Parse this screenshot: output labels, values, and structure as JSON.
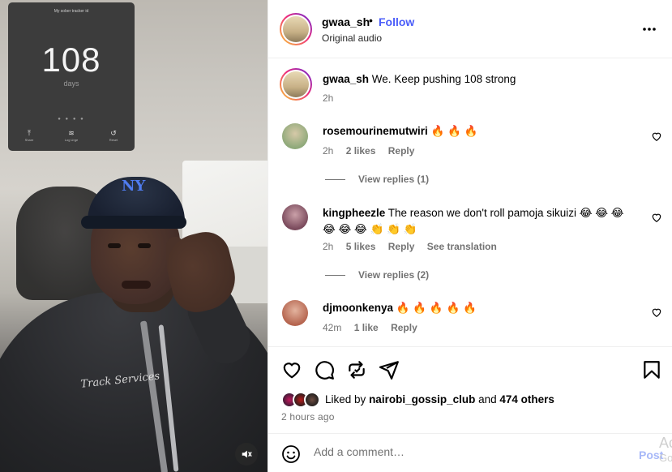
{
  "post": {
    "username": "gwaa_sh",
    "separator": "•",
    "follow_label": "Follow",
    "audio": "Original audio",
    "more_icon": "more-horizontal-icon"
  },
  "media": {
    "phone_goal_text": "My sober tracker id",
    "counter_value": "108",
    "counter_unit": "days",
    "controls": [
      {
        "glyph": "⤒",
        "label": "Share"
      },
      {
        "glyph": "≋",
        "label": "Log Urge"
      },
      {
        "glyph": "↺",
        "label": "Reset"
      }
    ],
    "mute_icon": "speaker-muted-icon",
    "cap_logo": "NY"
  },
  "caption": {
    "username": "gwaa_sh",
    "text": "We. Keep pushing 108 strong",
    "time": "2h"
  },
  "comments": [
    {
      "username": "rosemourinemutwiri",
      "text": "🔥 🔥 🔥",
      "time": "2h",
      "likes": "2 likes",
      "reply": "Reply",
      "view_replies": "View replies (1)",
      "avatar_color": "#8fa97a"
    },
    {
      "username": "kingpheezle",
      "text": "The reason we don't roll pamoja sikuizi 😂 😂 😂 😂 😂 😂 👏 👏 👏",
      "time": "2h",
      "likes": "5 likes",
      "reply": "Reply",
      "translation": "See translation",
      "view_replies": "View replies (2)",
      "avatar_color": "#7a4a5c"
    },
    {
      "username": "djmoonkenya",
      "text": "🔥 🔥 🔥 🔥 🔥",
      "time": "42m",
      "likes": "1 like",
      "reply": "Reply",
      "avatar_color": "#b5654f"
    }
  ],
  "actions": {
    "icons": [
      "heart-icon",
      "comment-icon",
      "repost-icon",
      "share-icon",
      "bookmark-icon"
    ],
    "liked_prefix": "Liked by",
    "liked_user": "nairobi_gossip_club",
    "liked_and": "and",
    "liked_others": "474 others",
    "time_ago": "2 hours ago"
  },
  "add_comment": {
    "placeholder": "Add a comment…",
    "post_label": "Post",
    "emoji_icon": "smiley-icon"
  },
  "overlay_text": {
    "line1": "Ac",
    "line2": "Go"
  },
  "colors": {
    "follow_blue": "#4a5df9",
    "post_disabled": "#a7b8f8",
    "muted_text": "#737373"
  }
}
